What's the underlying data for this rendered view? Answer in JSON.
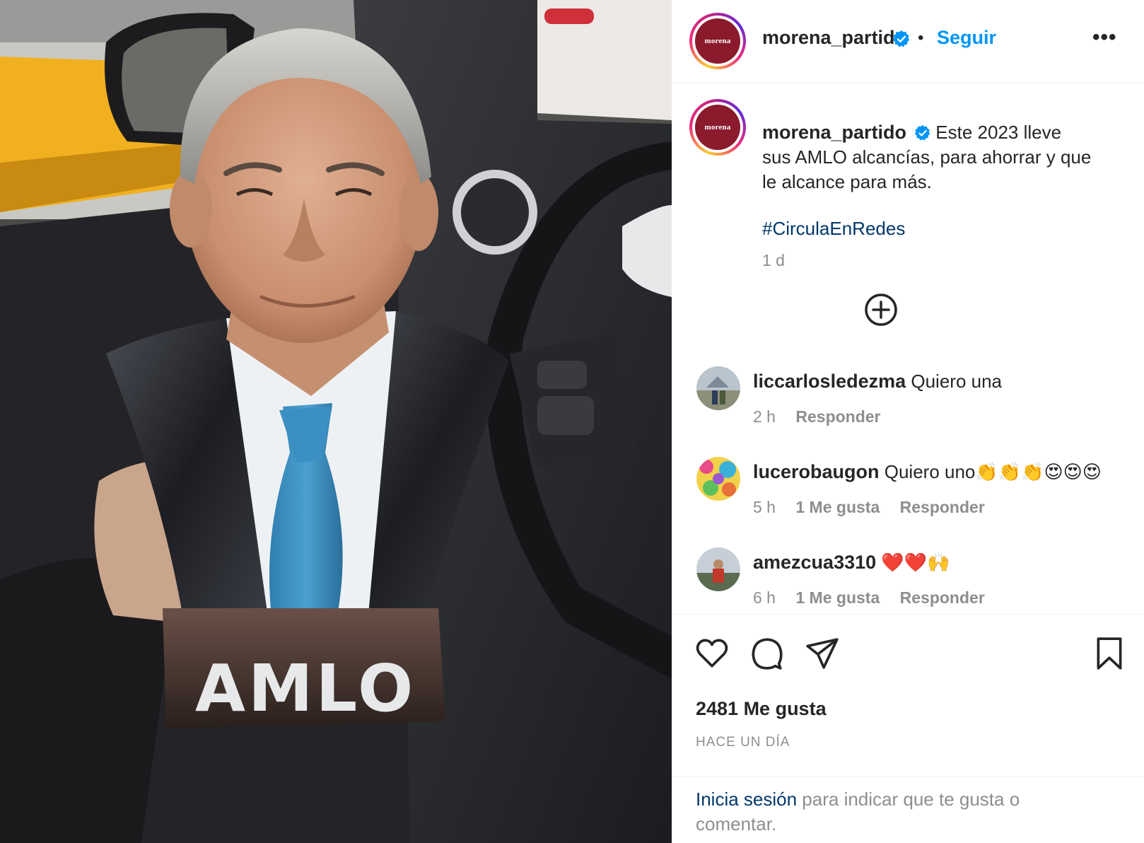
{
  "post": {
    "image_text": "AMLO",
    "image_alt_subject": "AMLO bust figurine held inside a car"
  },
  "header": {
    "avatar_text": "morena",
    "username": "morena_partido",
    "separator": "•",
    "follow_label": "Seguir",
    "more_label": "•••"
  },
  "caption": {
    "username": "morena_partido",
    "text": "Este 2023 lleve sus AMLO alcancías, para ahorrar y que le alcance para más.",
    "hashtag": "#CirculaEnRedes",
    "time": "1 d"
  },
  "comments": [
    {
      "username": "liccarlosledezma",
      "text": "Quiero una",
      "time": "2 h",
      "likes": "",
      "reply": "Responder"
    },
    {
      "username": "lucerobaugon",
      "text": "Quiero uno👏👏👏😍😍😍",
      "time": "5 h",
      "likes": "1 Me gusta",
      "reply": "Responder"
    },
    {
      "username": "amezcua3310",
      "text": "❤️❤️🙌",
      "time": "6 h",
      "likes": "1 Me gusta",
      "reply": "Responder"
    }
  ],
  "actions": {
    "likes_count": "2481 Me gusta",
    "post_date": "HACE UN DÍA"
  },
  "login": {
    "link_text": "Inicia sesión",
    "rest_text": " para indicar que te gusta o comentar."
  },
  "colors": {
    "accent": "#0095f6",
    "link": "#00376b",
    "muted": "#8e8e8e",
    "brand": "#8a1a2c"
  },
  "icons": [
    "verified-badge-icon",
    "more-options-icon",
    "load-more-comments-icon",
    "heart-icon",
    "comment-icon",
    "share-icon",
    "bookmark-icon"
  ]
}
